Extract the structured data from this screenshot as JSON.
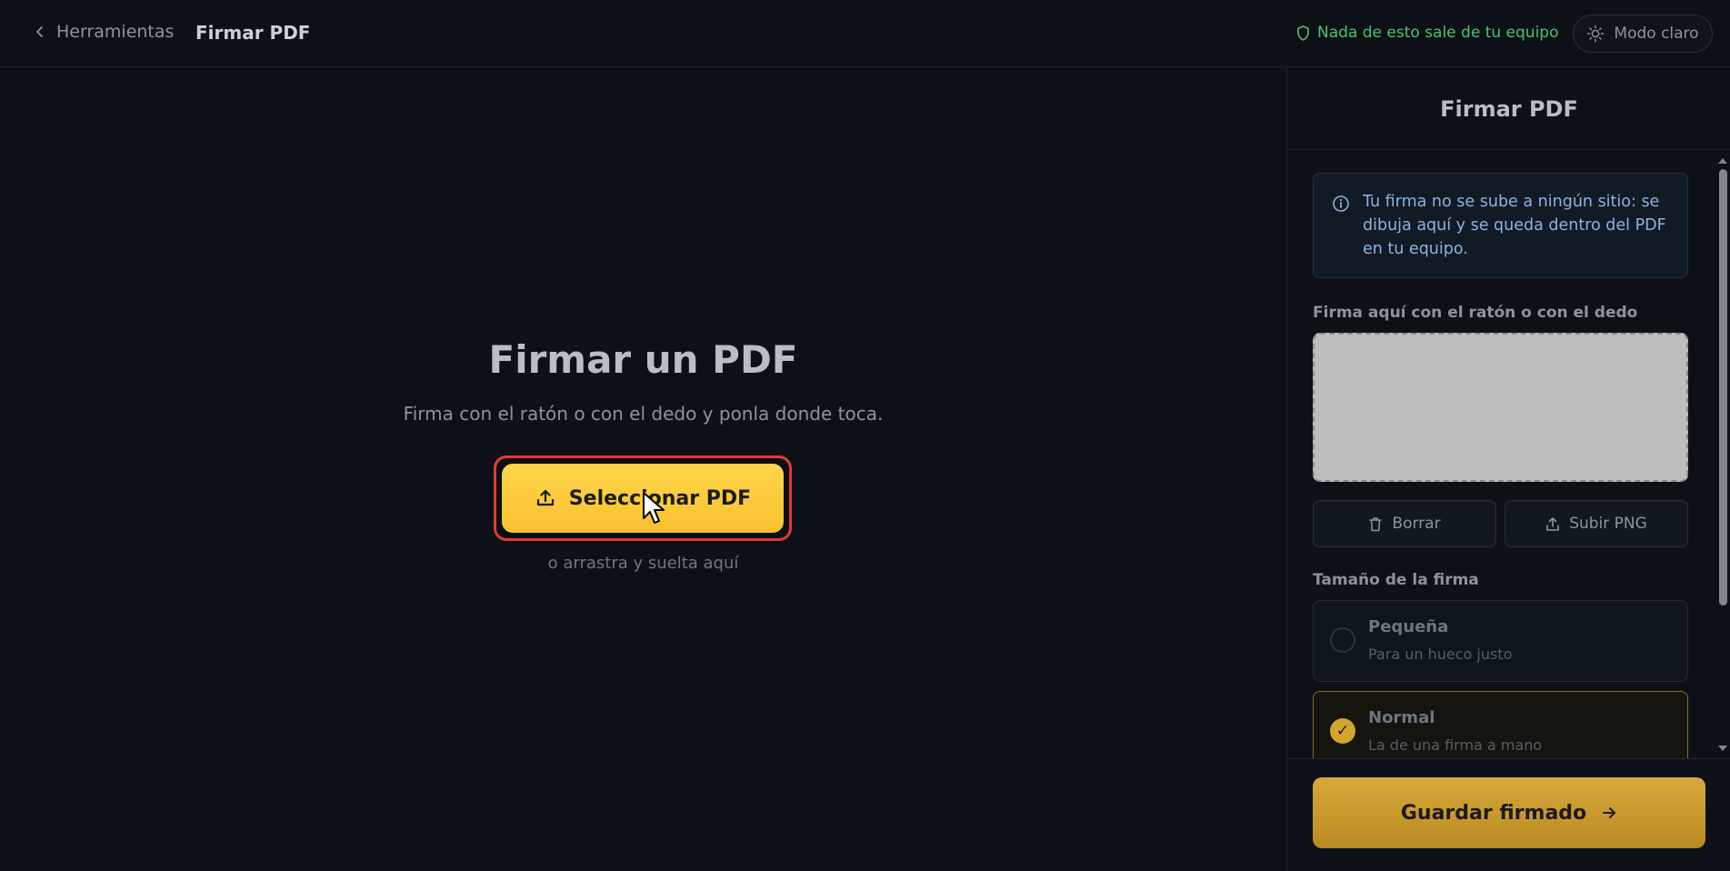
{
  "header": {
    "back_label": "Herramientas",
    "title": "Firmar PDF",
    "privacy_text": "Nada de esto sale de tu equipo",
    "theme_label": "Modo claro"
  },
  "main": {
    "title": "Firmar un PDF",
    "subtitle": "Firma con el ratón o con el dedo y ponla donde toca.",
    "select_button": "Seleccionar PDF",
    "drop_hint": "o arrastra y suelta aquí"
  },
  "panel": {
    "title": "Firmar PDF",
    "info": "Tu firma no se sube a ningún sitio: se dibuja aquí y se queda dentro del PDF en tu equipo.",
    "signature_label": "Firma aquí con el ratón o con el dedo",
    "clear_button": "Borrar",
    "upload_png_button": "Subir PNG",
    "size_label": "Tamaño de la firma",
    "size_options": [
      {
        "title": "Pequeña",
        "desc": "Para un hueco justo",
        "selected": false
      },
      {
        "title": "Normal",
        "desc": "La de una firma a mano",
        "selected": true
      }
    ],
    "save_button": "Guardar firmado"
  },
  "colors": {
    "accent": "#f8c12f",
    "privacy_green": "#4ec26b",
    "highlight_red": "#e5393a",
    "background": "#0d1117"
  },
  "icons": [
    "chevron-left-icon",
    "shield-icon",
    "sun-icon",
    "upload-icon",
    "info-icon",
    "trash-icon",
    "arrow-right-icon",
    "check-icon",
    "mouse-cursor-icon"
  ]
}
